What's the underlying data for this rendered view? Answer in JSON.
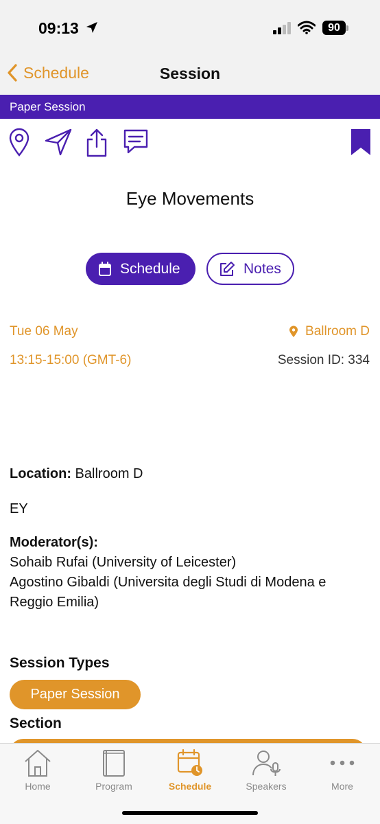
{
  "status_bar": {
    "time": "09:13",
    "battery": "90"
  },
  "nav": {
    "back_label": "Schedule",
    "title": "Session"
  },
  "banner": {
    "session_type": "Paper Session"
  },
  "action_icons": [
    "location-pin-icon",
    "navigate-icon",
    "share-icon",
    "comment-icon",
    "bookmark-icon"
  ],
  "session": {
    "title": "Eye Movements",
    "schedule_button": "Schedule",
    "notes_button": "Notes",
    "date": "Tue 06 May",
    "room": "Ballroom D",
    "time": "13:15-15:00 (GMT-6)",
    "session_id": "Session ID: 334"
  },
  "details": {
    "location_label": "Location:",
    "location_value": " Ballroom D",
    "code": "EY",
    "moderators_label": "Moderator(s):",
    "moderator_1": "Sohaib Rufai (University of Leicester)",
    "moderator_2": "Agostino Gibaldi (Universita degli Studi di Modena e Reggio Emilia)",
    "session_types_label": "Session Types",
    "session_type_pill": "Paper Session",
    "section_label": "Section"
  },
  "tabs": [
    {
      "label": "Home",
      "icon": "home-icon",
      "active": false
    },
    {
      "label": "Program",
      "icon": "book-icon",
      "active": false
    },
    {
      "label": "Schedule",
      "icon": "calendar-clock-icon",
      "active": true
    },
    {
      "label": "Speakers",
      "icon": "speaker-icon",
      "active": false
    },
    {
      "label": "More",
      "icon": "more-dots-icon",
      "active": false
    }
  ],
  "colors": {
    "brand_purple": "#4a1fb0",
    "accent_orange": "#e0952a"
  }
}
